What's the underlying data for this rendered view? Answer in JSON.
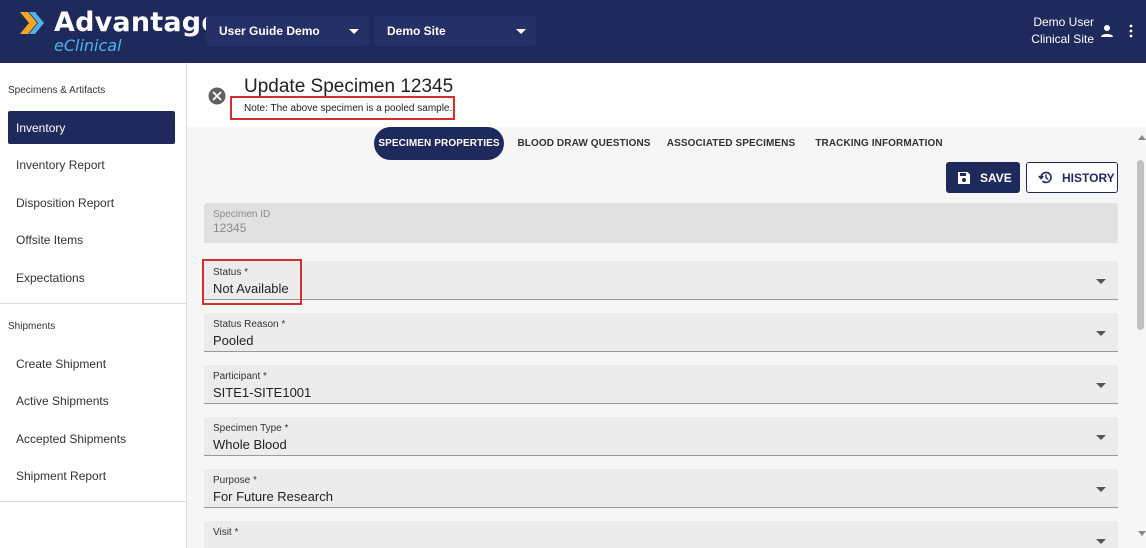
{
  "app": {
    "brand_main": "Advantage",
    "brand_sub": "eClinical",
    "colors": {
      "primary": "#1f2a5c",
      "accent": "#4fb3e8",
      "logo_orange": "#f5a623",
      "highlight_red": "#d32f2f"
    }
  },
  "header": {
    "study_select": "User Guide Demo",
    "site_select": "Demo Site",
    "user_name": "Demo User",
    "user_site": "Clinical Site",
    "icons": [
      "person-icon",
      "more-vert-icon",
      "chevron-down-icon"
    ]
  },
  "sidebar": {
    "section1_title": "Specimens & Artifacts",
    "section1_items": [
      "Inventory",
      "Inventory Report",
      "Disposition Report",
      "Offsite Items",
      "Expectations"
    ],
    "section2_title": "Shipments",
    "section2_items": [
      "Create Shipment",
      "Active Shipments",
      "Accepted Shipments",
      "Shipment Report"
    ],
    "active_item": "Inventory"
  },
  "page": {
    "title": "Update Specimen 12345",
    "note": "Note: The above specimen is a pooled sample."
  },
  "tabs": [
    "SPECIMEN PROPERTIES",
    "BLOOD DRAW QUESTIONS",
    "ASSOCIATED SPECIMENS",
    "TRACKING INFORMATION"
  ],
  "active_tab": "SPECIMEN PROPERTIES",
  "buttons": {
    "save": "SAVE",
    "history": "HISTORY"
  },
  "fields": {
    "specimen_id": {
      "label": "Specimen ID",
      "value": "12345"
    },
    "status": {
      "label": "Status *",
      "value": "Not Available"
    },
    "status_reason": {
      "label": "Status Reason *",
      "value": "Pooled"
    },
    "participant": {
      "label": "Participant *",
      "value": "SITE1-SITE1001"
    },
    "specimen_type": {
      "label": "Specimen Type *",
      "value": "Whole Blood"
    },
    "purpose": {
      "label": "Purpose *",
      "value": "For Future Research"
    },
    "visit": {
      "label": "Visit *",
      "value": ""
    }
  }
}
